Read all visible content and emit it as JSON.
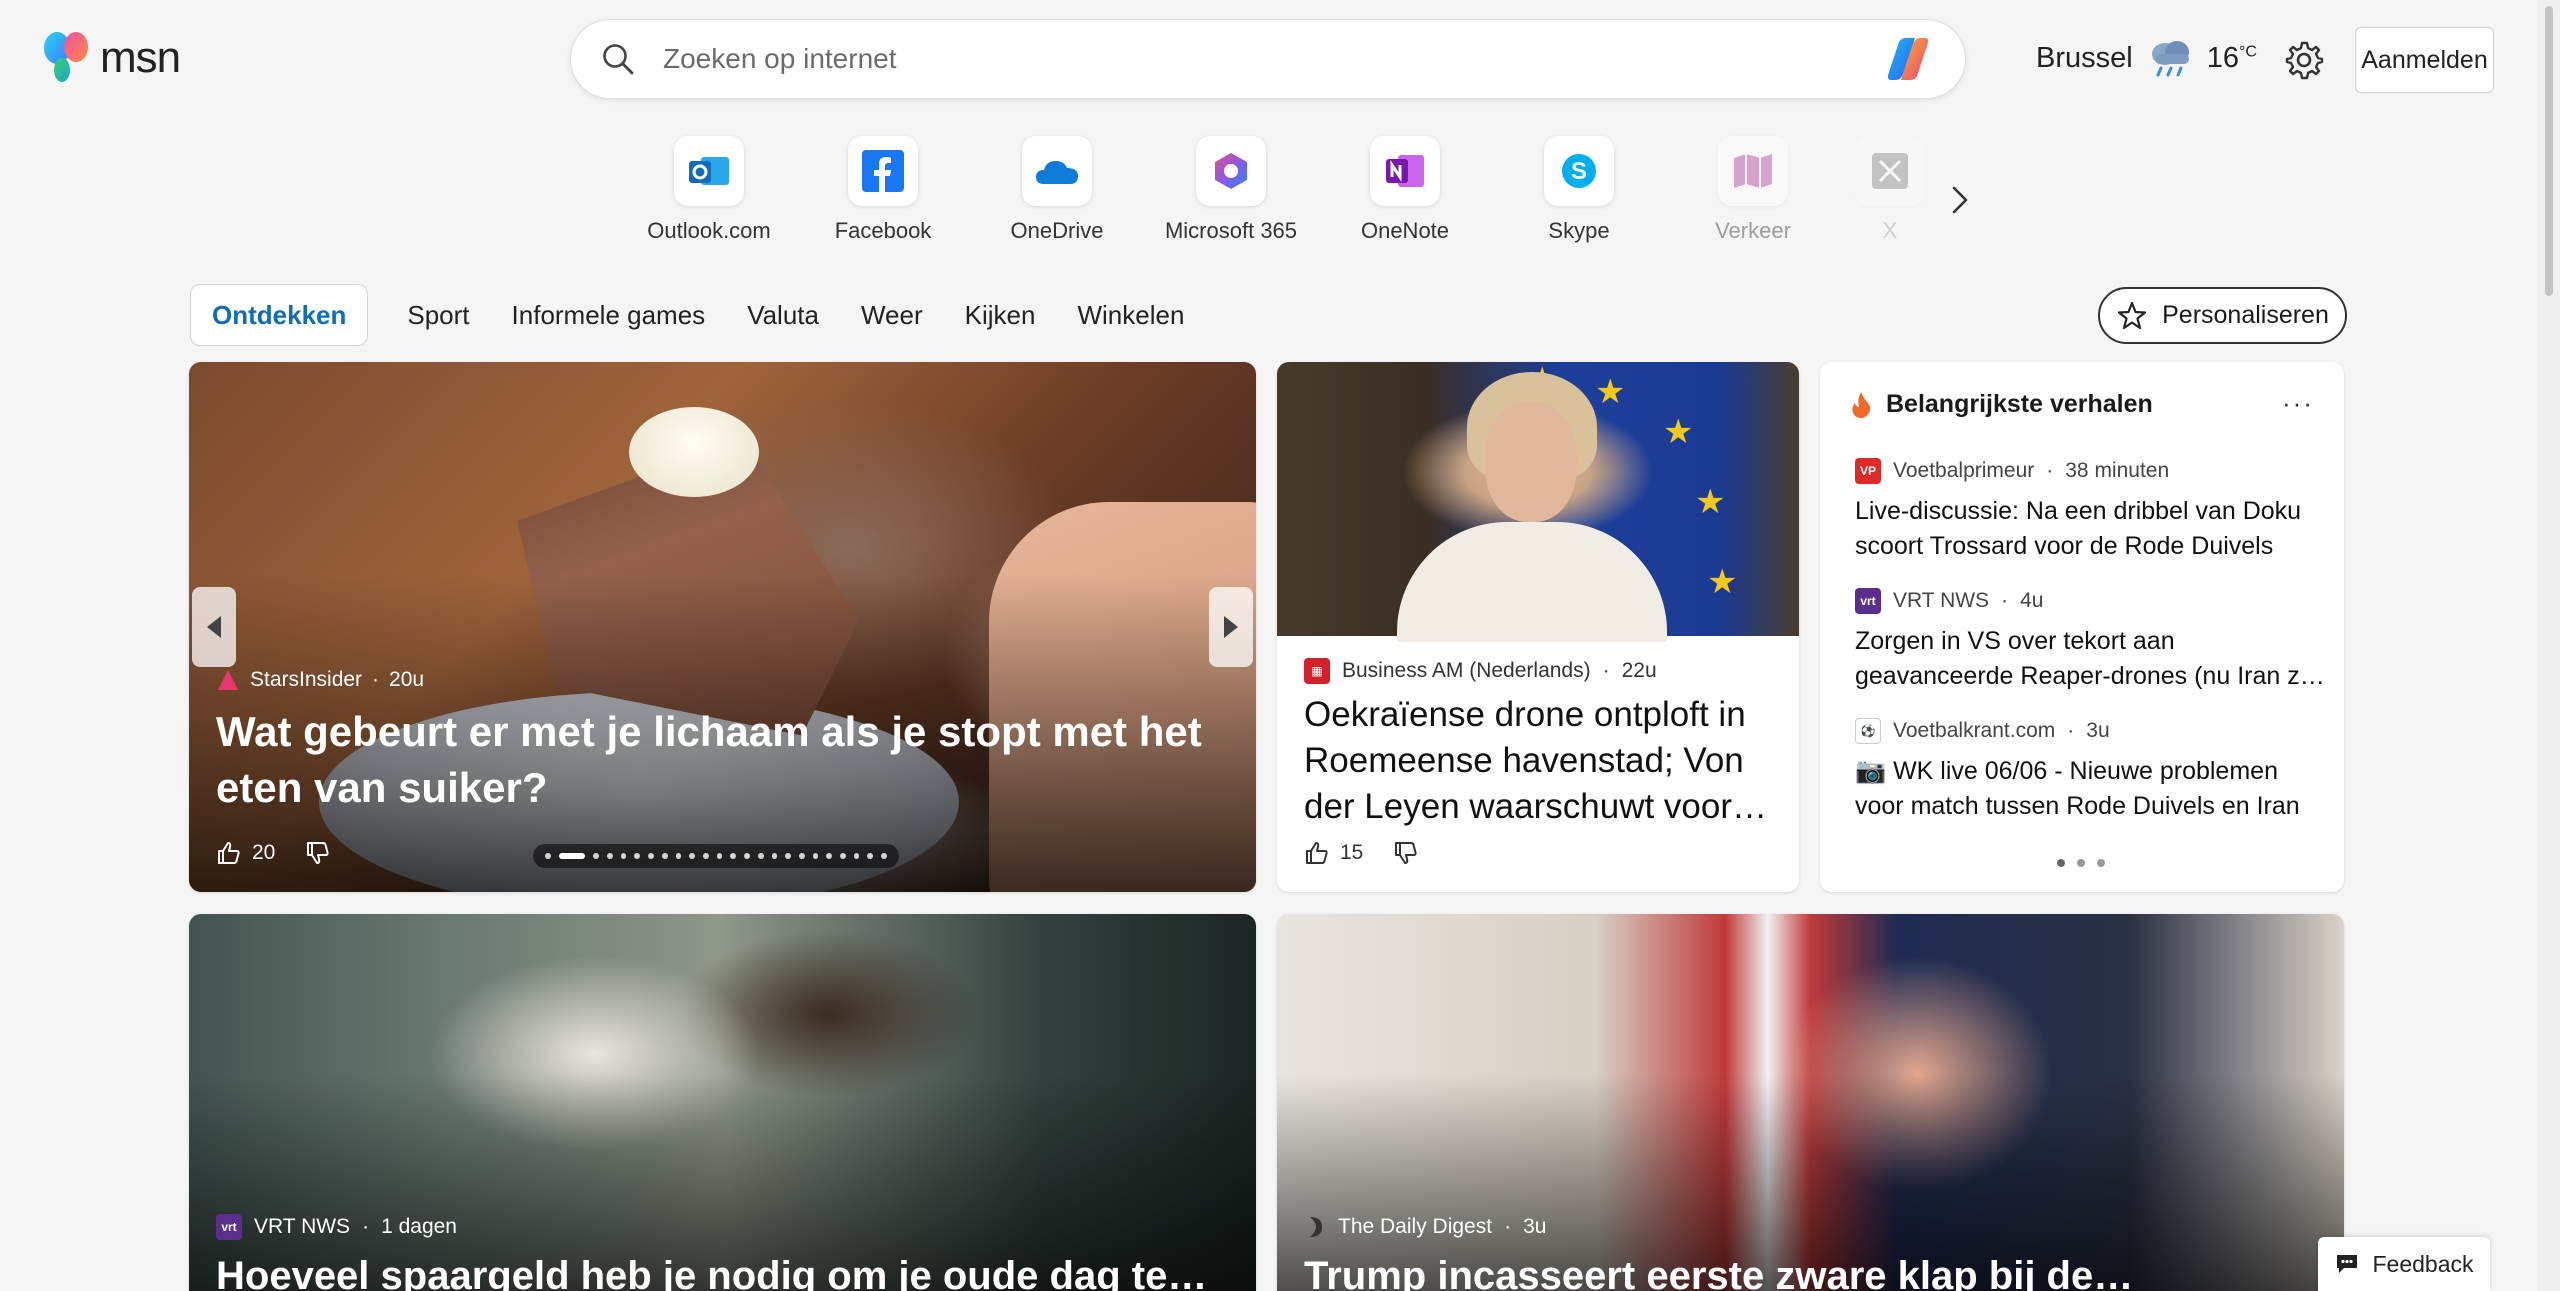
{
  "header": {
    "logo_text": "msn",
    "search_placeholder": "Zoeken op internet",
    "weather_city": "Brussel",
    "weather_temp": "16",
    "weather_unit": "°C",
    "signin_label": "Aanmelden"
  },
  "quicklinks": [
    {
      "label": "Outlook.com",
      "icon": "outlook-icon"
    },
    {
      "label": "Facebook",
      "icon": "facebook-icon"
    },
    {
      "label": "OneDrive",
      "icon": "onedrive-icon"
    },
    {
      "label": "Microsoft 365",
      "icon": "microsoft-365-icon"
    },
    {
      "label": "OneNote",
      "icon": "onenote-icon"
    },
    {
      "label": "Skype",
      "icon": "skype-icon"
    },
    {
      "label": "Verkeer",
      "icon": "traffic-map-icon"
    },
    {
      "label": "X",
      "icon": "x-icon"
    }
  ],
  "nav": {
    "tabs": [
      "Ontdekken",
      "Sport",
      "Informele games",
      "Valuta",
      "Weer",
      "Kijken",
      "Winkelen"
    ],
    "personalize_label": "Personaliseren"
  },
  "hero": {
    "source": "StarsInsider",
    "age": "20u",
    "title": "Wat gebeurt er met je lichaam als je stopt met het eten van suiker?",
    "likes": "20"
  },
  "news2": {
    "source": "Business AM (Nederlands)",
    "age": "22u",
    "title": "Oekraïense drone ontploft in Roemeense havenstad; Von der Leyen waarschuwt voor…",
    "likes": "15"
  },
  "top_stories": {
    "heading": "Belangrijkste verhalen",
    "more": "···",
    "items": [
      {
        "source": "Voetbalprimeur",
        "age": "38 minuten",
        "title": "Live-discussie: Na een dribbel van Doku scoort Trossard voor de Rode Duivels"
      },
      {
        "source": "VRT NWS",
        "age": "4u",
        "title": "Zorgen in VS over tekort aan geavanceerde Reaper-drones (nu Iran z…"
      },
      {
        "source": "Voetbalkrant.com",
        "age": "3u",
        "title": "📷 WK live 06/06 - Nieuwe problemen voor match tussen Rode Duivels en Iran"
      }
    ]
  },
  "bottom_cards": [
    {
      "source": "VRT NWS",
      "age": "1 dagen",
      "title": "Hoeveel spaargeld heb je nodig om je oude dag te…"
    },
    {
      "source": "The Daily Digest",
      "age": "3u",
      "title": "Trump incasseert eerste zware klap bij de…"
    }
  ],
  "feedback_label": "Feedback",
  "colors": {
    "accent": "#0f6cbd",
    "background": "#f5f5f5"
  }
}
